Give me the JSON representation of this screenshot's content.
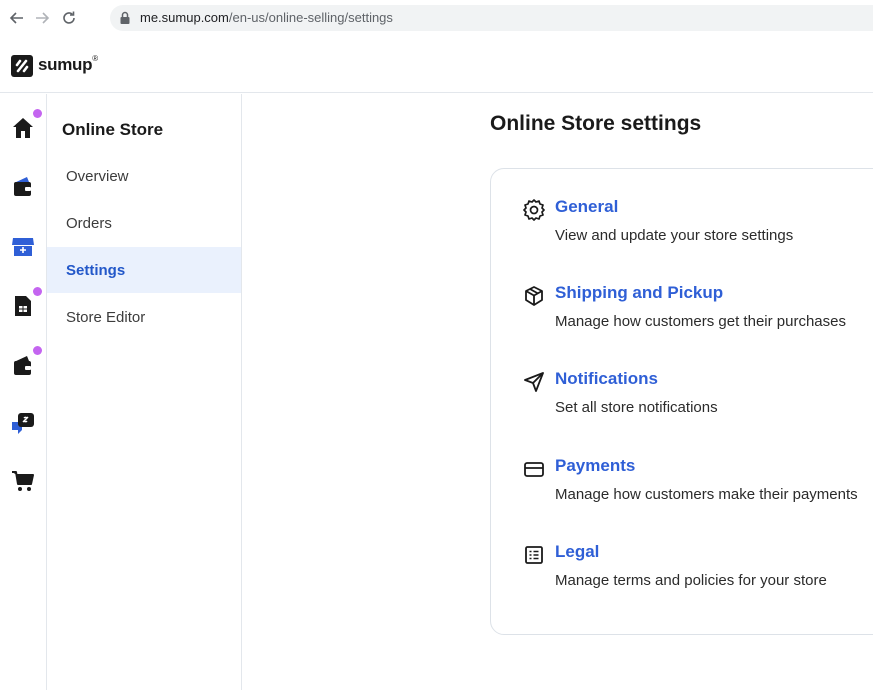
{
  "browser": {
    "url_domain": "me.sumup.com",
    "url_path": "/en-us/online-selling/settings"
  },
  "app": {
    "logo_text": "sumup",
    "logo_mark": "®"
  },
  "rail": {
    "items": [
      {
        "icon": "home-icon",
        "badge": true
      },
      {
        "icon": "wallet-icon",
        "badge": false
      },
      {
        "icon": "store-icon",
        "badge": false
      },
      {
        "icon": "invoice-icon",
        "badge": true
      },
      {
        "icon": "wallet-icon",
        "badge": true
      },
      {
        "icon": "payment-link-icon",
        "badge": false
      },
      {
        "icon": "cart-icon",
        "badge": false
      }
    ]
  },
  "subnav": {
    "title": "Online Store",
    "items": [
      {
        "label": "Overview"
      },
      {
        "label": "Orders"
      },
      {
        "label": "Settings",
        "active": true
      },
      {
        "label": "Store Editor"
      }
    ]
  },
  "main": {
    "title": "Online Store settings",
    "settings": [
      {
        "icon": "gear-icon",
        "title": "General",
        "description": "View and update your store settings"
      },
      {
        "icon": "package-icon",
        "title": "Shipping and Pickup",
        "description": "Manage how customers get their purchases"
      },
      {
        "icon": "send-icon",
        "title": "Notifications",
        "description": "Set all store notifications"
      },
      {
        "icon": "card-icon",
        "title": "Payments",
        "description": "Manage how customers make their payments"
      },
      {
        "icon": "document-icon",
        "title": "Legal",
        "description": "Manage terms and policies for your store"
      }
    ]
  },
  "colors": {
    "accent": "#2f5fd6",
    "active_bg": "#eaf1fd",
    "badge": "#c465f0"
  }
}
